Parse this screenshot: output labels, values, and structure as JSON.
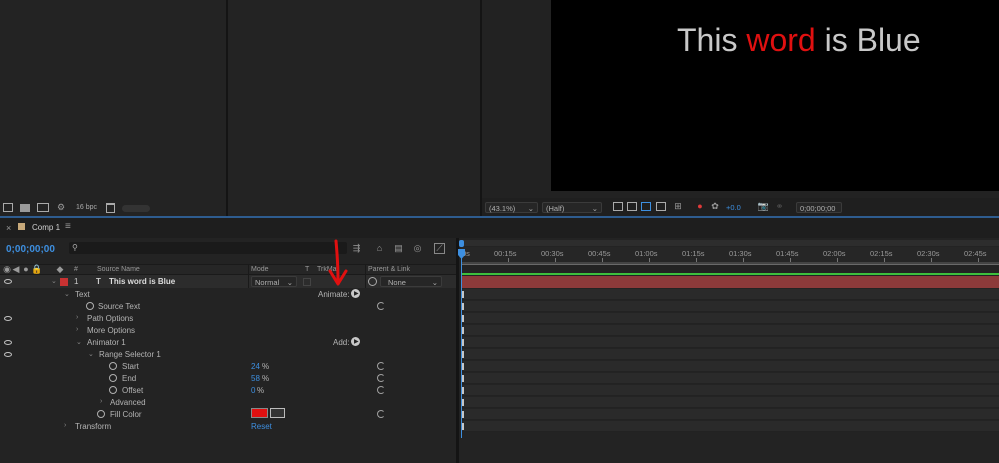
{
  "preview": {
    "text": {
      "part1": "This ",
      "word": "word",
      "part2": " is Blue"
    },
    "zoom": "(43.1%)",
    "resolution": "(Half)",
    "exposure": "+0.0",
    "timecode": "0;00;00;00"
  },
  "project": {
    "bpc": "16 bpc"
  },
  "comp_tab": {
    "label": "Comp 1",
    "menu": "≡"
  },
  "timeline": {
    "current_time": "0;00;00;00",
    "search_placeholder": "",
    "columns": {
      "source_name": "Source Name",
      "mode": "Mode",
      "t": "T",
      "trkmat": "TrkMat",
      "parent": "Parent & Link",
      "hash": "#"
    },
    "ruler_ticks": [
      "0s",
      "00:15s",
      "00:30s",
      "00:45s",
      "01:00s",
      "01:15s",
      "01:30s",
      "01:45s",
      "02:00s",
      "02:15s",
      "02:30s",
      "02:45s"
    ],
    "layer": {
      "number": "1",
      "type_icon": "T",
      "name": "This word is Blue",
      "mode": "Normal",
      "parent": "None",
      "label_color": "#c83232"
    },
    "properties": {
      "text": "Text",
      "animate": "Animate:",
      "source_text": "Source Text",
      "path_options": "Path Options",
      "more_options": "More Options",
      "animator": "Animator 1",
      "add": "Add:",
      "range_selector": "Range Selector 1",
      "start_label": "Start",
      "start_value": "24",
      "end_label": "End",
      "end_value": "58",
      "offset_label": "Offset",
      "offset_value": "0",
      "percent": "%",
      "advanced": "Advanced",
      "fill_color": "Fill Color",
      "fill_swatch": "#e01010",
      "transform": "Transform",
      "reset": "Reset"
    }
  },
  "colors": {
    "accent_blue": "#3d8fe0",
    "preview_red": "#e01010",
    "layer_bar": "#8c3a3a",
    "annotation_arrow": "#e01010"
  }
}
